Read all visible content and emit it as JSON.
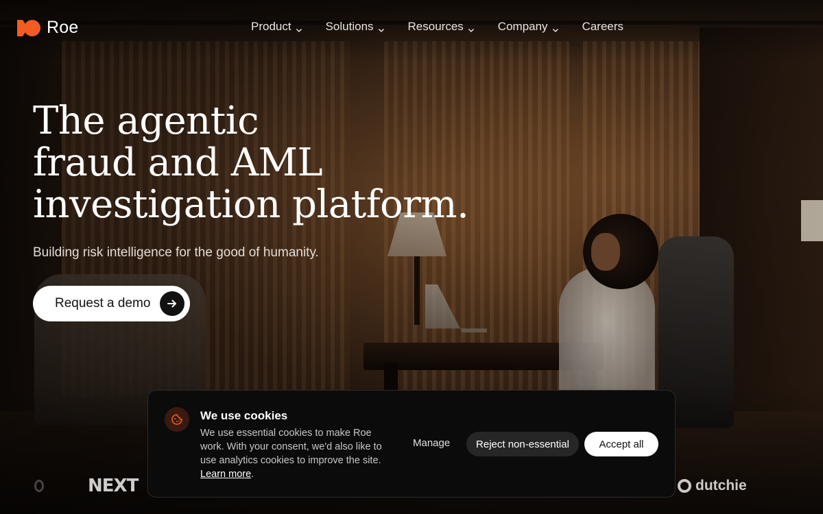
{
  "brand": {
    "name": "Roe",
    "accent": "#f25c22"
  },
  "nav": {
    "items": [
      {
        "label": "Product",
        "icon": "chevron-down-icon"
      },
      {
        "label": "Solutions",
        "icon": "chevron-down-icon"
      },
      {
        "label": "Resources",
        "icon": "chevron-down-icon"
      },
      {
        "label": "Company",
        "icon": "chevron-down-icon"
      },
      {
        "label": "Careers"
      }
    ]
  },
  "hero": {
    "title_lines": [
      "The agentic",
      "fraud and AML",
      "investigation platform."
    ],
    "subtitle": "Building risk intelligence for the good of humanity.",
    "cta_label": "Request a demo",
    "cta_icon": "arrow-right-icon"
  },
  "customer_logos": [
    "NEXT",
    "dutchie"
  ],
  "cookie_banner": {
    "icon": "cookie-icon",
    "title": "We use cookies",
    "body": "We use essential cookies to make Roe work. With your consent, we'd also like to use analytics cookies to improve the site.",
    "link_label": "Learn more",
    "trailing": ".",
    "manage_label": "Manage",
    "reject_label": "Reject non-essential",
    "accept_label": "Accept all"
  }
}
